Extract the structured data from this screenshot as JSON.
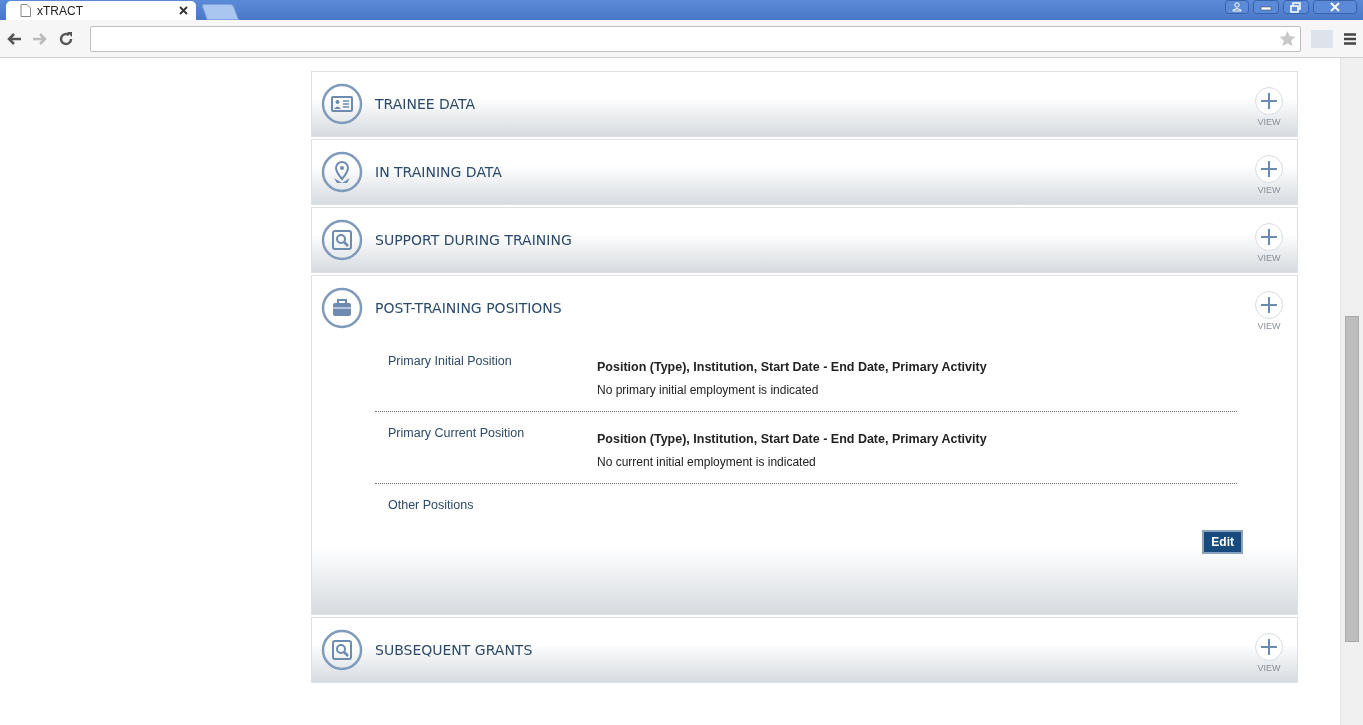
{
  "browser": {
    "tab_title": "xTRACT"
  },
  "sections": [
    {
      "title": "TRAINEE DATA",
      "view_label": "VIEW",
      "expanded": false
    },
    {
      "title": "IN TRAINING DATA",
      "view_label": "VIEW",
      "expanded": false
    },
    {
      "title": "SUPPORT DURING TRAINING",
      "view_label": "VIEW",
      "expanded": false
    },
    {
      "title": "POST-TRAINING POSITIONS",
      "view_label": "VIEW",
      "expanded": true,
      "rows": [
        {
          "label": "Primary Initial Position",
          "heading": "Position (Type), Institution, Start Date - End Date, Primary Activity",
          "text": "No primary initial employment is indicated"
        },
        {
          "label": "Primary Current Position",
          "heading": "Position (Type), Institution, Start Date - End Date, Primary Activity",
          "text": "No current initial employment is indicated"
        },
        {
          "label": "Other Positions"
        }
      ],
      "edit_button": "Edit"
    },
    {
      "title": "SUBSEQUENT GRANTS",
      "view_label": "VIEW",
      "expanded": false
    }
  ]
}
